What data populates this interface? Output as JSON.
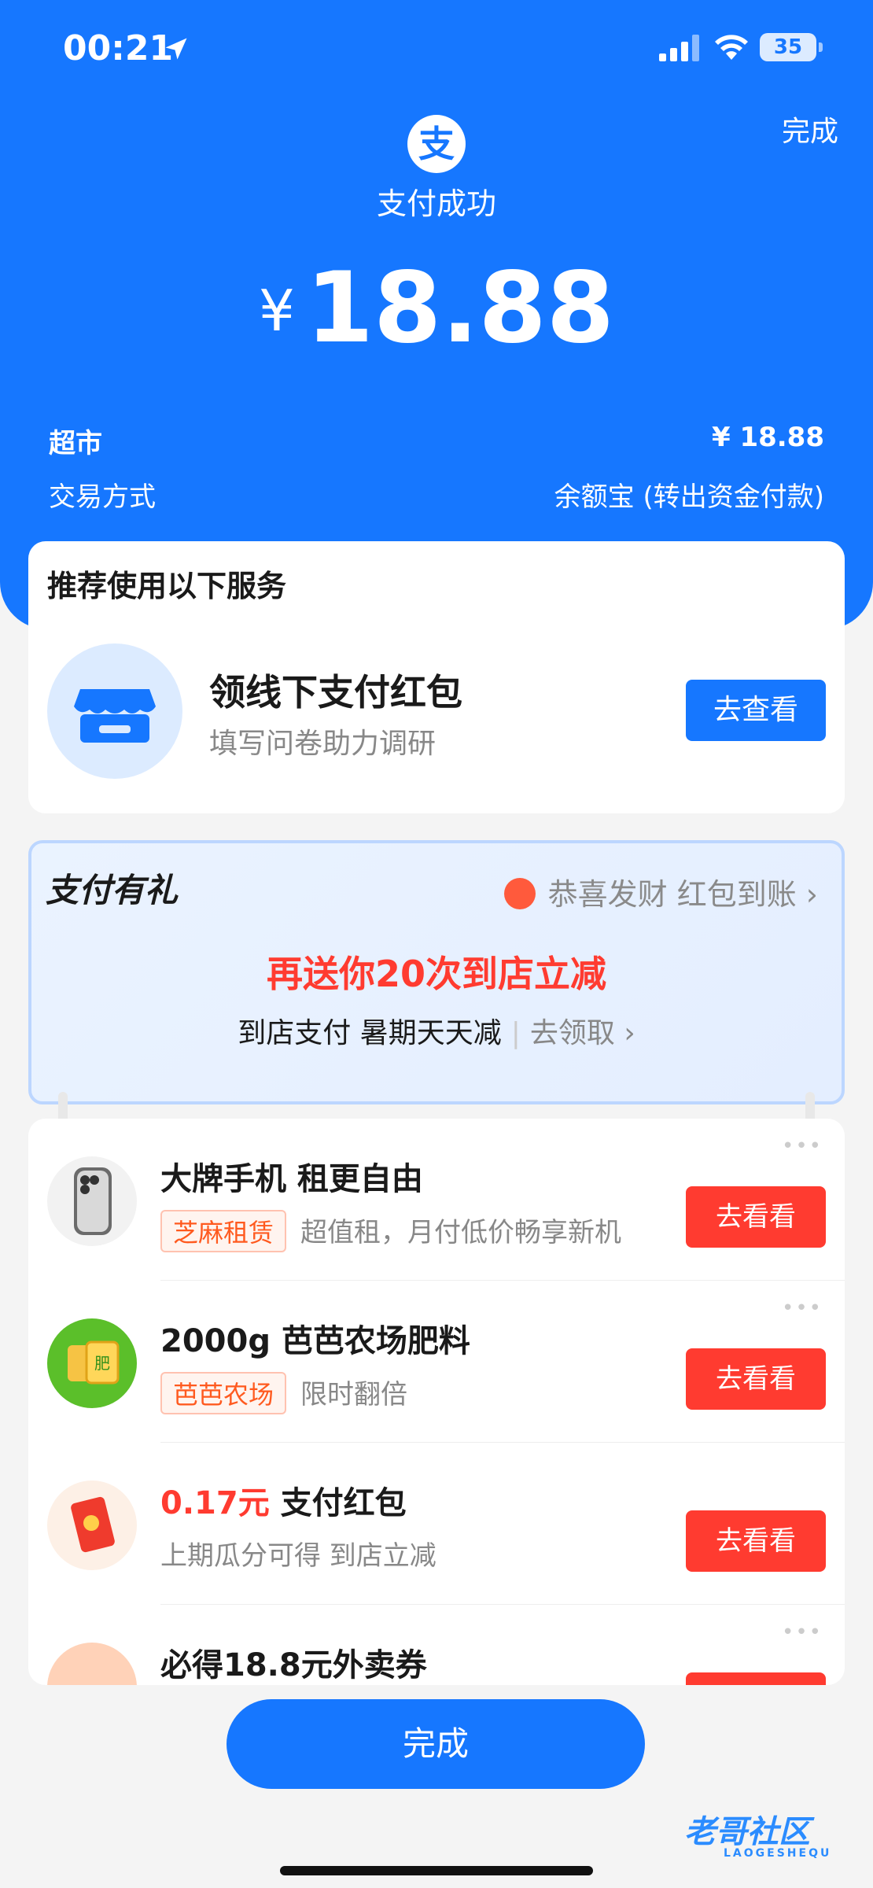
{
  "status_bar": {
    "time": "00:21",
    "battery": "35"
  },
  "header": {
    "done_label": "完成",
    "logo_char": "支",
    "status_text": "支付成功",
    "currency": "¥",
    "amount": "18.88"
  },
  "details": {
    "merchant": "超市",
    "merchant_amount": "¥ 18.88",
    "method_label": "交易方式",
    "method_value": "余额宝 (转出资金付款)"
  },
  "service_card": {
    "title": "推荐使用以下服务",
    "name": "领线下支付红包",
    "subtitle": "填写问卷助力调研",
    "button": "去查看"
  },
  "gift_card": {
    "title": "支付有礼",
    "notice": "恭喜发财 红包到账",
    "headline": "再送你20次到店立减",
    "subline": "到店支付 暑期天天减",
    "link": "去领取"
  },
  "list_items": [
    {
      "title": "大牌手机 租更自由",
      "tag": "芝麻租赁",
      "subtitle": "超值租，月付低价畅享新机",
      "button": "去看看"
    },
    {
      "title": "2000g 芭芭农场肥料",
      "tag": "芭芭农场",
      "subtitle": "限时翻倍",
      "button": "去看看"
    },
    {
      "title_red": "0.17元",
      "title": " 支付红包",
      "subtitle": "上期瓜分可得 到店立减",
      "button": "去看看"
    },
    {
      "title": "必得18.8元外卖券"
    }
  ],
  "bottom": {
    "done_button": "完成",
    "watermark": "老哥社区",
    "watermark_sub": "LAOGESHEQU"
  },
  "colors": {
    "primary": "#1677ff",
    "danger": "#ff3b30",
    "tag_orange": "#ff5a1f"
  },
  "icons": [
    "location-arrow-icon",
    "signal-icon",
    "wifi-icon",
    "battery-icon",
    "alipay-logo-icon",
    "store-icon",
    "gift-badge-icon",
    "chevron-right-icon",
    "phone-icon",
    "fertilizer-icon",
    "red-envelope-icon",
    "takeout-icon",
    "more-dots-icon"
  ]
}
